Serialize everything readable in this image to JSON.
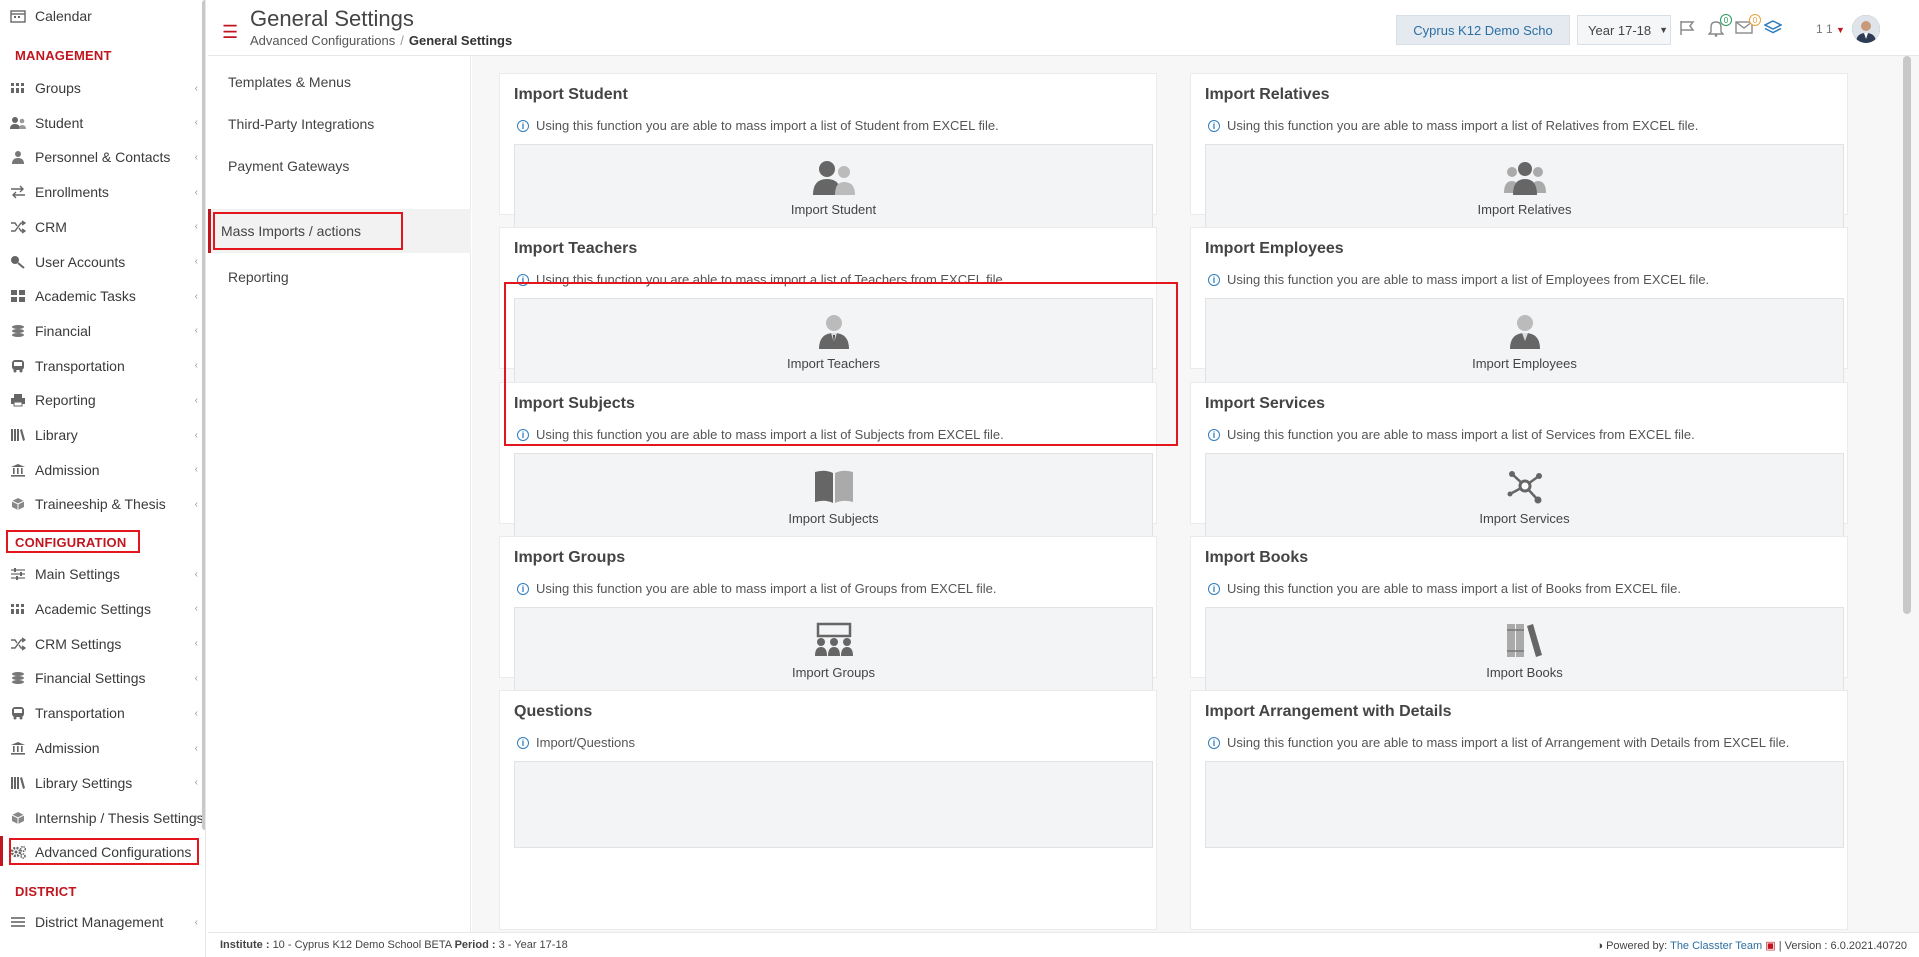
{
  "sidebar": {
    "items_top": [
      {
        "label": "Calendar",
        "icon": "calendar-icon"
      }
    ],
    "management_header": "MANAGEMENT",
    "management": [
      {
        "label": "Groups",
        "icon": "groups-icon"
      },
      {
        "label": "Student",
        "icon": "student-icon"
      },
      {
        "label": "Personnel & Contacts",
        "icon": "person-icon"
      },
      {
        "label": "Enrollments",
        "icon": "exchange-icon"
      },
      {
        "label": "CRM",
        "icon": "shuffle-icon"
      },
      {
        "label": "User Accounts",
        "icon": "key-icon"
      },
      {
        "label": "Academic Tasks",
        "icon": "tasks-icon"
      },
      {
        "label": "Financial",
        "icon": "coins-icon"
      },
      {
        "label": "Transportation",
        "icon": "bus-icon"
      },
      {
        "label": "Reporting",
        "icon": "printer-icon"
      },
      {
        "label": "Library",
        "icon": "library-icon"
      },
      {
        "label": "Admission",
        "icon": "institution-icon"
      },
      {
        "label": "Traineeship & Thesis",
        "icon": "cube-icon"
      }
    ],
    "configuration_header": "CONFIGURATION",
    "configuration": [
      {
        "label": "Main Settings",
        "icon": "sliders-icon"
      },
      {
        "label": "Academic Settings",
        "icon": "groups-icon"
      },
      {
        "label": "CRM Settings",
        "icon": "shuffle-icon"
      },
      {
        "label": "Financial Settings",
        "icon": "coins-icon"
      },
      {
        "label": "Transportation",
        "icon": "bus-icon"
      },
      {
        "label": "Admission",
        "icon": "institution-icon"
      },
      {
        "label": "Library Settings",
        "icon": "library-icon"
      },
      {
        "label": "Internship / Thesis Settings",
        "icon": "cube-icon"
      },
      {
        "label": "Advanced Configurations",
        "icon": "gears-icon"
      }
    ],
    "district_header": "DISTRICT",
    "district": [
      {
        "label": "District Management",
        "icon": "list-icon"
      }
    ]
  },
  "header": {
    "title": "General Settings",
    "breadcrumb_parent": "Advanced Configurations",
    "breadcrumb_sep": "/",
    "breadcrumb_current": "General Settings",
    "school": "Cyprus K12 Demo Scho",
    "year": "Year 17-18",
    "notifications_count": "0",
    "messages_count": "0",
    "user_label": "1 1"
  },
  "subnav": [
    {
      "label": "Templates & Menus"
    },
    {
      "label": "Third-Party Integrations"
    },
    {
      "label": "Payment Gateways"
    },
    {
      "label": "Mass Imports / actions"
    },
    {
      "label": "Reporting"
    }
  ],
  "cards": [
    {
      "title": "Import Student",
      "desc": "Using this function you are able to mass import a list of Student from EXCEL file.",
      "action": "Import Student",
      "icon": "users-icon"
    },
    {
      "title": "Import Relatives",
      "desc": "Using this function you are able to mass import a list of Relatives from EXCEL file.",
      "action": "Import Relatives",
      "icon": "relatives-icon"
    },
    {
      "title": "Import Teachers",
      "desc": "Using this function you are able to mass import a list of Teachers from EXCEL file.",
      "action": "Import Teachers",
      "icon": "teacher-icon"
    },
    {
      "title": "Import Employees",
      "desc": "Using this function you are able to mass import a list of Employees from EXCEL file.",
      "action": "Import Employees",
      "icon": "employee-icon"
    },
    {
      "title": "Import Subjects",
      "desc": "Using this function you are able to mass import a list of Subjects from EXCEL file.",
      "action": "Import Subjects",
      "icon": "book-icon"
    },
    {
      "title": "Import Services",
      "desc": "Using this function you are able to mass import a list of Services from EXCEL file.",
      "action": "Import Services",
      "icon": "services-icon"
    },
    {
      "title": "Import Groups",
      "desc": "Using this function you are able to mass import a list of Groups from EXCEL file.",
      "action": "Import Groups",
      "icon": "classroom-icon"
    },
    {
      "title": "Import Books",
      "desc": "Using this function you are able to mass import a list of Books from EXCEL file.",
      "action": "Import Books",
      "icon": "books-icon"
    },
    {
      "title": "Questions",
      "desc": "Import/Questions",
      "action": "",
      "icon": ""
    },
    {
      "title": "Import Arrangement with Details",
      "desc": "Using this function you are able to mass import a list of Arrangement with Details from EXCEL file.",
      "action": "",
      "icon": ""
    }
  ],
  "footer": {
    "institute_label": "Institute :",
    "institute_value": "10 - Cyprus K12 Demo School BETA",
    "period_label": "Period :",
    "period_value": "3 - Year 17-18",
    "powered_label": "Powered by:",
    "powered_link": "The Classter Team",
    "version_label": "Version :",
    "version_value": "6.0.2021.40720"
  },
  "colors": {
    "accent_red": "#c0161f",
    "highlight_box": "#e3161d",
    "link_blue": "#2c6fa3"
  }
}
